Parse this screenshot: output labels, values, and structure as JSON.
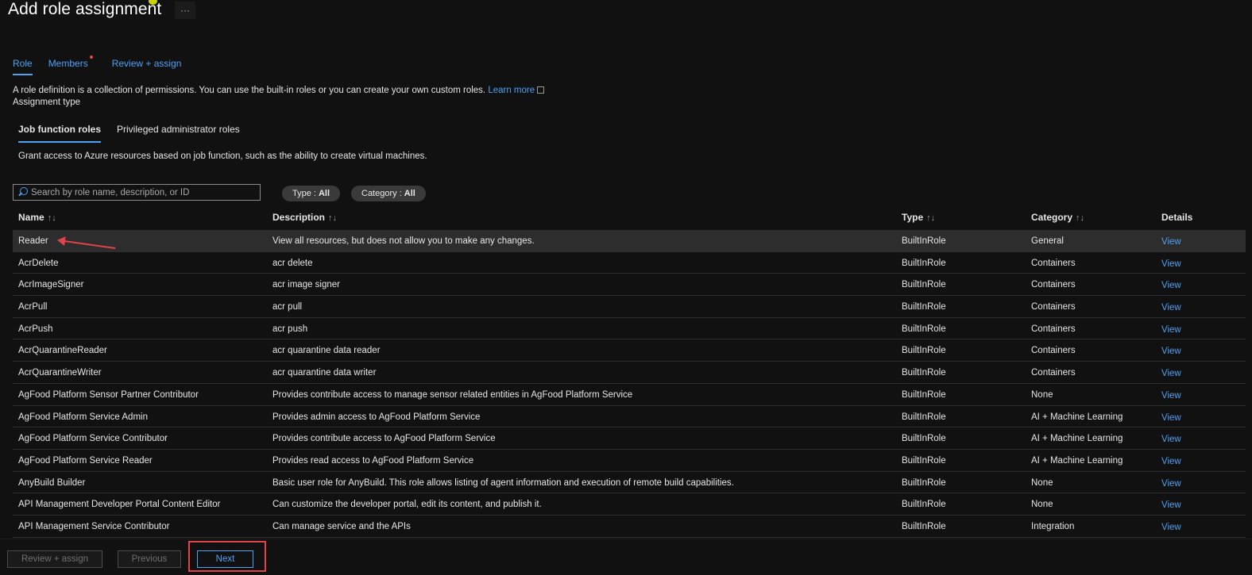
{
  "page": {
    "title": "Add role assignment",
    "more_label": "···"
  },
  "tabs": [
    {
      "label": "Role",
      "active": true
    },
    {
      "label": "Members",
      "required": true
    },
    {
      "label": "Review + assign"
    }
  ],
  "description": {
    "text": "A role definition is a collection of permissions. You can use the built-in roles or you can create your own custom roles. ",
    "link": "Learn more"
  },
  "assignment_type_label": "Assignment type",
  "subtabs": [
    {
      "label": "Job function roles",
      "active": true
    },
    {
      "label": "Privileged administrator roles"
    }
  ],
  "grant_text": "Grant access to Azure resources based on job function, such as the ability to create virtual machines.",
  "search": {
    "placeholder": "Search by role name, description, or ID",
    "value": ""
  },
  "filters": {
    "type": {
      "label": "Type :",
      "value": "All"
    },
    "category": {
      "label": "Category :",
      "value": "All"
    }
  },
  "columns": {
    "name": "Name",
    "description": "Description",
    "type": "Type",
    "category": "Category",
    "details": "Details",
    "sort_glyph": "↑↓"
  },
  "rows": [
    {
      "name": "Reader",
      "description": "View all resources, but does not allow you to make any changes.",
      "type": "BuiltInRole",
      "category": "General",
      "details": "View"
    },
    {
      "name": "AcrDelete",
      "description": "acr delete",
      "type": "BuiltInRole",
      "category": "Containers",
      "details": "View"
    },
    {
      "name": "AcrImageSigner",
      "description": "acr image signer",
      "type": "BuiltInRole",
      "category": "Containers",
      "details": "View"
    },
    {
      "name": "AcrPull",
      "description": "acr pull",
      "type": "BuiltInRole",
      "category": "Containers",
      "details": "View"
    },
    {
      "name": "AcrPush",
      "description": "acr push",
      "type": "BuiltInRole",
      "category": "Containers",
      "details": "View"
    },
    {
      "name": "AcrQuarantineReader",
      "description": "acr quarantine data reader",
      "type": "BuiltInRole",
      "category": "Containers",
      "details": "View"
    },
    {
      "name": "AcrQuarantineWriter",
      "description": "acr quarantine data writer",
      "type": "BuiltInRole",
      "category": "Containers",
      "details": "View"
    },
    {
      "name": "AgFood Platform Sensor Partner Contributor",
      "description": "Provides contribute access to manage sensor related entities in AgFood Platform Service",
      "type": "BuiltInRole",
      "category": "None",
      "details": "View"
    },
    {
      "name": "AgFood Platform Service Admin",
      "description": "Provides admin access to AgFood Platform Service",
      "type": "BuiltInRole",
      "category": "AI + Machine Learning",
      "details": "View"
    },
    {
      "name": "AgFood Platform Service Contributor",
      "description": "Provides contribute access to AgFood Platform Service",
      "type": "BuiltInRole",
      "category": "AI + Machine Learning",
      "details": "View"
    },
    {
      "name": "AgFood Platform Service Reader",
      "description": "Provides read access to AgFood Platform Service",
      "type": "BuiltInRole",
      "category": "AI + Machine Learning",
      "details": "View"
    },
    {
      "name": "AnyBuild Builder",
      "description": "Basic user role for AnyBuild. This role allows listing of agent information and execution of remote build capabilities.",
      "type": "BuiltInRole",
      "category": "None",
      "details": "View"
    },
    {
      "name": "API Management Developer Portal Content Editor",
      "description": "Can customize the developer portal, edit its content, and publish it.",
      "type": "BuiltInRole",
      "category": "None",
      "details": "View"
    },
    {
      "name": "API Management Service Contributor",
      "description": "Can manage service and the APIs",
      "type": "BuiltInRole",
      "category": "Integration",
      "details": "View"
    }
  ],
  "footer": {
    "review_assign": "Review + assign",
    "previous": "Previous",
    "next": "Next"
  },
  "colors": {
    "accent": "#4ea1f3",
    "annotation": "#e0444a"
  }
}
